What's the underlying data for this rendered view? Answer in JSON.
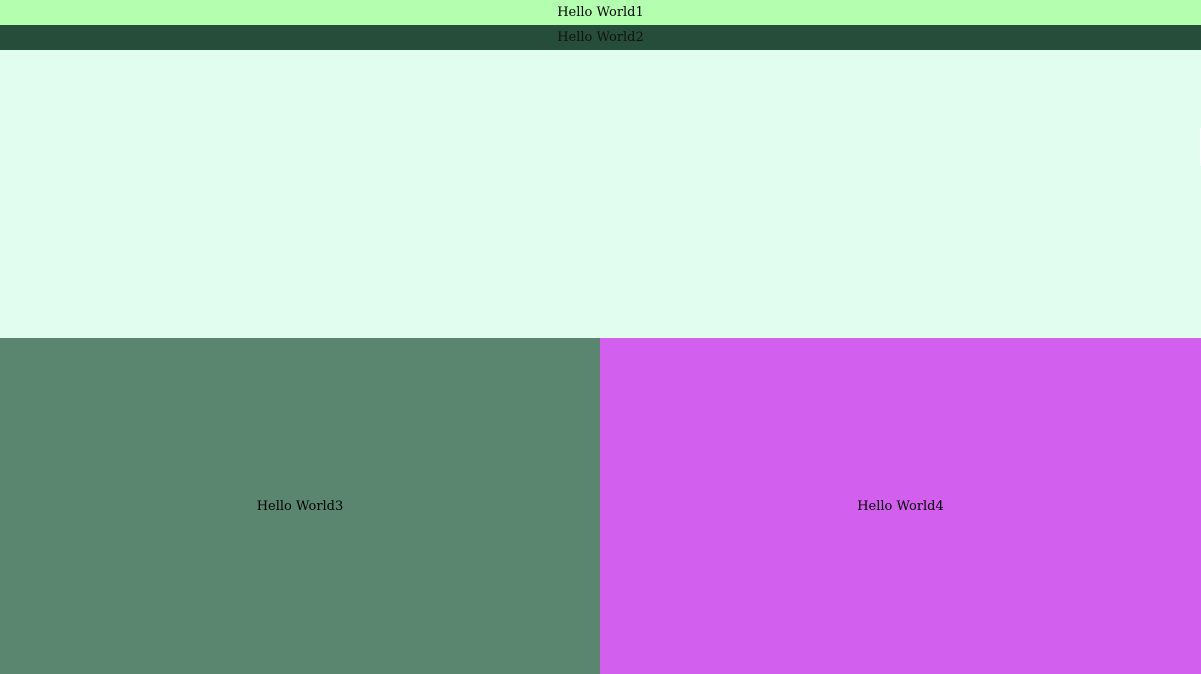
{
  "header": {
    "primary_text": "Hello World1",
    "primary_color": "#b3ffaf",
    "secondary_text": "Hello World2",
    "secondary_color": "#264d3a"
  },
  "content": {
    "background_color": "#e0fdf0"
  },
  "panels": {
    "left": {
      "text": "Hello World3",
      "color": "#5a8670"
    },
    "right": {
      "text": "Hello World4",
      "color": "#d35fef"
    }
  }
}
